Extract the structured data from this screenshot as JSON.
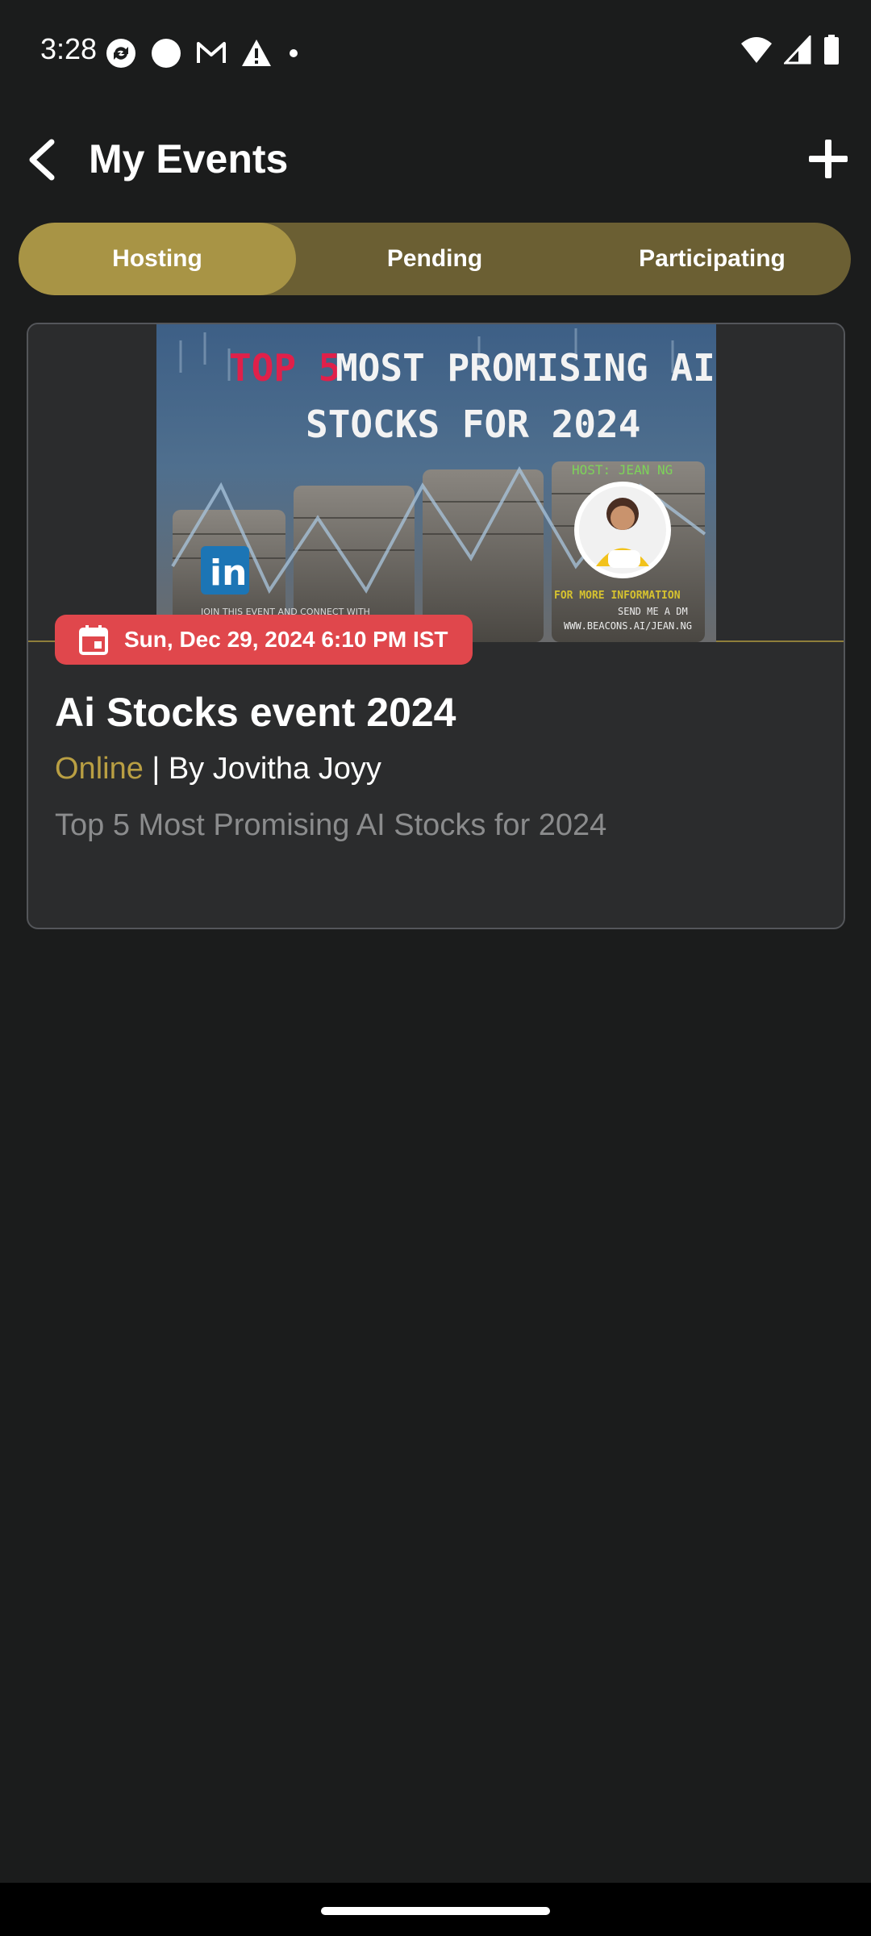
{
  "status_bar": {
    "time": "3:28",
    "left_icons": [
      "sync-icon",
      "circle-icon",
      "gmail-icon",
      "warning-icon",
      "dot-icon"
    ],
    "right_icons": [
      "wifi-icon",
      "signal-icon",
      "battery-icon"
    ]
  },
  "header": {
    "title": "My Events",
    "back_icon": "chevron-left-icon",
    "add_icon": "plus-icon"
  },
  "tabs": [
    {
      "label": "Hosting",
      "active": true
    },
    {
      "label": "Pending",
      "active": false
    },
    {
      "label": "Participating",
      "active": false
    }
  ],
  "event": {
    "banner": {
      "headline_accent": "TOP 5",
      "headline_line1": "MOST PROMISING AI",
      "headline_line2": "STOCKS FOR 2024",
      "host": "HOST: JEAN NG",
      "join_text": "JOIN THIS EVENT AND CONNECT WITH",
      "info_title": "FOR MORE INFORMATION",
      "info_line1": "SEND ME A DM",
      "info_line2": "WWW.BEACONS.AI/JEAN.NG",
      "linkedin": "in"
    },
    "date": "Sun, Dec 29, 2024 6:10 PM IST",
    "date_icon": "calendar-icon",
    "title": "Ai Stocks event 2024",
    "mode": "Online",
    "byline": " | By Jovitha Joyy",
    "description": "Top 5 Most Promising AI Stocks for 2024"
  },
  "colors": {
    "background": "#1b1c1c",
    "accent_gold": "#a89445",
    "tab_track": "#6b5f33",
    "badge_red": "#e0474c",
    "card": "#2b2c2d"
  }
}
